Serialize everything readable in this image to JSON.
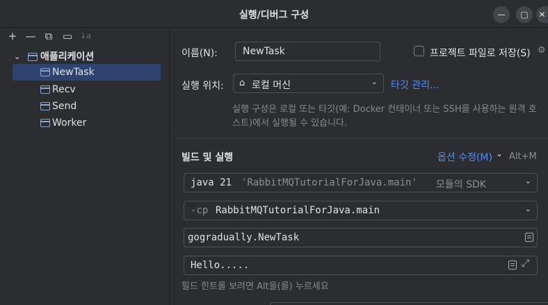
{
  "window": {
    "title": "실행/디버그 구성",
    "minimize_icon": "minimize-icon",
    "maximize_icon": "maximize-icon",
    "close_icon": "close-icon"
  },
  "toolbar": {
    "add": "+",
    "remove": "—",
    "copy": "⧉",
    "new_folder": "▭",
    "sort": "↓a"
  },
  "tree": {
    "group_label": "애플리케이션",
    "items": [
      {
        "label": "NewTask",
        "selected": true
      },
      {
        "label": "Recv",
        "selected": false
      },
      {
        "label": "Send",
        "selected": false
      },
      {
        "label": "Worker",
        "selected": false
      }
    ]
  },
  "form": {
    "name_label": "이름(N):",
    "name_value": "NewTask",
    "store_label": "프로젝트 파일로 저장(S)",
    "location_label": "실행 위치:",
    "location_value": "로컬 머신",
    "manage_targets": "타깃 관리…",
    "hint_line1": "실행 구성은 로컬 또는 타깃(예: Docker 컨테이너 또는 SSH를 사용하는 원격 호",
    "hint_line2": "스트)에서 실행될 수 있습니다.",
    "section_title": "빌드 및 실행",
    "modify_options": "옵션 수정(M)",
    "modify_shortcut": "Alt+M",
    "sdk_java": "java 21",
    "sdk_module": "'RabbitMQTutorialForJava.main'",
    "sdk_suffix": "모듈의 SDK",
    "cp_flag": "-cp",
    "cp_value": "RabbitMQTutorialForJava.main",
    "main_class": "gogradually.NewTask",
    "program_args": "Hello.....",
    "field_hint": "필드 힌트를 보려면 Alt을(를) 누르세요"
  },
  "colors": {
    "background": "#2b2d30",
    "selection": "#2e436e",
    "link": "#548af7",
    "border": "#4e5157"
  }
}
